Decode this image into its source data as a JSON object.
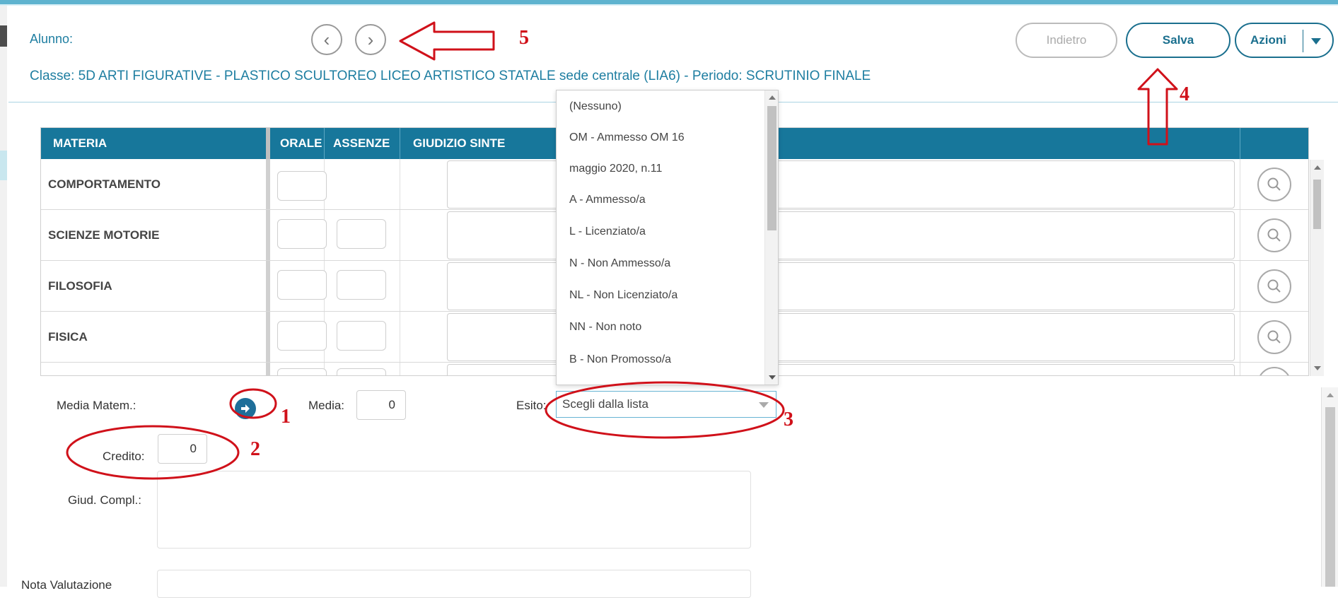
{
  "header": {
    "alunno_label": "Alunno:",
    "prev_icon": "chevron-left-icon",
    "next_icon": "chevron-right-icon",
    "classe_text": "Classe: 5D ARTI FIGURATIVE - PLASTICO SCULTOREO LICEO ARTISTICO STATALE sede centrale (LIA6) - Periodo: SCRUTINIO FINALE"
  },
  "actions": {
    "indietro": "Indietro",
    "salva": "Salva",
    "azioni": "Azioni"
  },
  "table": {
    "columns": [
      "MATERIA",
      "ORALE",
      "ASSENZE",
      "GIUDIZIO SINTE"
    ],
    "rows": [
      {
        "materia": "COMPORTAMENTO"
      },
      {
        "materia": "SCIENZE MOTORIE"
      },
      {
        "materia": "FILOSOFIA"
      },
      {
        "materia": "FISICA"
      }
    ]
  },
  "dropdown": {
    "options": [
      "(Nessuno)",
      "OM - Ammesso OM 16",
      "maggio 2020, n.11",
      "A - Ammesso/a",
      "L - Licenziato/a",
      "N - Non Ammesso/a",
      "NL - Non Licenziato/a",
      "NN - Non noto",
      "B - Non Promosso/a"
    ]
  },
  "form": {
    "media_matem_label": "Media Matem.:",
    "media_label": "Media:",
    "media_value": "0",
    "esito_label": "Esito:",
    "esito_placeholder": "Scegli dalla lista",
    "credito_label": "Credito:",
    "credito_value": "0",
    "giud_compl_label": "Giud. Compl.:",
    "nota_valutazione_label": "Nota Valutazione"
  },
  "annotations": [
    "1",
    "2",
    "3",
    "4",
    "5"
  ],
  "colors": {
    "accent": "#17779b",
    "link": "#1e7ea1",
    "annotation": "#d0111a"
  }
}
